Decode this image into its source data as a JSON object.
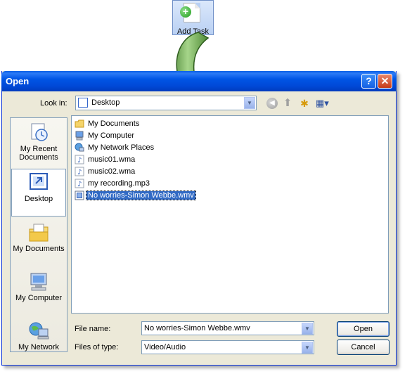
{
  "add_task": {
    "label": "Add Task"
  },
  "dialog": {
    "title": "Open",
    "help_glyph": "?",
    "close_glyph": "✕",
    "look_in": {
      "label": "Look in:",
      "value": "Desktop"
    }
  },
  "places": [
    {
      "label_line1": "My Recent",
      "label_line2": "Documents",
      "icon": "recent-documents-icon"
    },
    {
      "label_line1": "Desktop",
      "label_line2": "",
      "icon": "desktop-icon"
    },
    {
      "label_line1": "My Documents",
      "label_line2": "",
      "icon": "my-documents-icon"
    },
    {
      "label_line1": "My Computer",
      "label_line2": "",
      "icon": "my-computer-icon"
    },
    {
      "label_line1": "My Network",
      "label_line2": "",
      "icon": "my-network-icon"
    }
  ],
  "files": [
    {
      "name": "My Documents",
      "icon": "folder-icon"
    },
    {
      "name": "My Computer",
      "icon": "computer-icon"
    },
    {
      "name": "My Network Places",
      "icon": "network-places-icon"
    },
    {
      "name": "music01.wma",
      "icon": "audio-file-icon"
    },
    {
      "name": "music02.wma",
      "icon": "audio-file-icon"
    },
    {
      "name": "my recording.mp3",
      "icon": "audio-file-icon"
    },
    {
      "name": "No worries-Simon Webbe.wmv",
      "icon": "video-file-icon",
      "selected": true
    }
  ],
  "file_name": {
    "label": "File name:",
    "value": "No worries-Simon Webbe.wmv"
  },
  "files_of_type": {
    "label": "Files of type:",
    "value": "Video/Audio"
  },
  "buttons": {
    "open": "Open",
    "cancel": "Cancel"
  }
}
